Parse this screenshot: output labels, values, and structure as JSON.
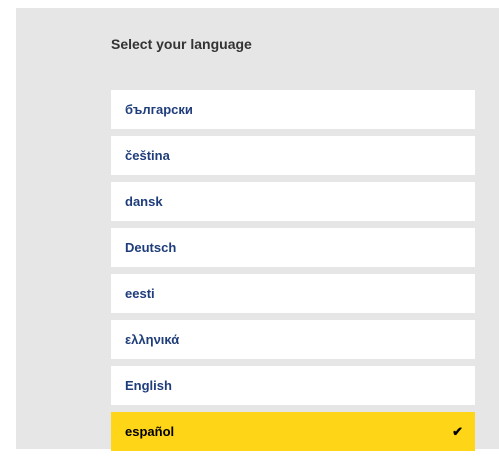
{
  "header": {
    "title": "Select your language"
  },
  "languages": [
    {
      "label": "български",
      "selected": false
    },
    {
      "label": "čeština",
      "selected": false
    },
    {
      "label": "dansk",
      "selected": false
    },
    {
      "label": "Deutsch",
      "selected": false
    },
    {
      "label": "eesti",
      "selected": false
    },
    {
      "label": "ελληνικά",
      "selected": false
    },
    {
      "label": "English",
      "selected": false
    },
    {
      "label": "español",
      "selected": true
    }
  ],
  "icons": {
    "selected": "check-icon"
  },
  "colors": {
    "panel_background": "#e6e6e6",
    "item_background": "#ffffff",
    "selected_background": "#ffd617",
    "link_text": "#1f3d7a"
  }
}
